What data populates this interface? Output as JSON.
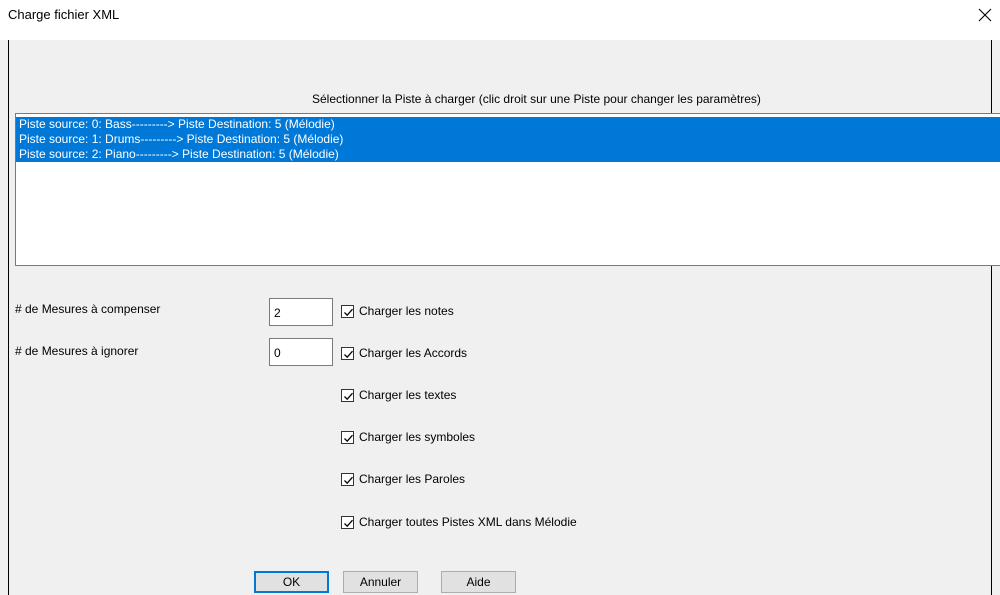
{
  "window": {
    "title": "Charge fichier XML",
    "close_icon": "close-icon"
  },
  "track_list": {
    "caption": "Sélectionner la Piste à charger (clic droit sur une Piste pour changer les paramètres)",
    "items": [
      "Piste source:  0: Bass---------> Piste Destination: 5 (Mélodie)",
      "Piste source:  1: Drums---------> Piste Destination: 5 (Mélodie)",
      "Piste source:  2: Piano---------> Piste Destination: 5 (Mélodie)"
    ],
    "selection_color": "#0078d7"
  },
  "fields": {
    "offset_label": "# de Mesures à compenser",
    "offset_value": "2",
    "ignore_label": "# de Mesures à ignorer",
    "ignore_value": "0"
  },
  "options": [
    {
      "label": "Charger les notes",
      "checked": true
    },
    {
      "label": "Charger les Accords",
      "checked": true
    },
    {
      "label": "Charger les textes",
      "checked": true
    },
    {
      "label": "Charger les symboles",
      "checked": true
    },
    {
      "label": "Charger les Paroles",
      "checked": true
    },
    {
      "label": "Charger toutes Pistes XML dans Mélodie",
      "checked": true
    }
  ],
  "buttons": {
    "ok": "OK",
    "cancel": "Annuler",
    "help": "Aide"
  }
}
